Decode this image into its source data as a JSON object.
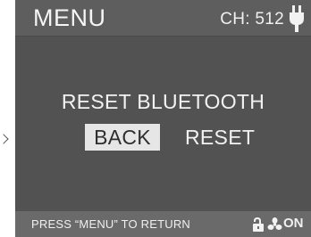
{
  "header": {
    "title": "MENU",
    "channel": "CH: 512",
    "power_icon": "plug-icon"
  },
  "dialog": {
    "headline": "RESET BLUETOOTH",
    "options": [
      {
        "label": "BACK",
        "selected": true
      },
      {
        "label": "RESET",
        "selected": false
      }
    ]
  },
  "footer": {
    "hint": "PRESS “MENU” TO RETURN",
    "lock_icon": "unlocked-padlock-icon",
    "fan_icon": "fan-icon",
    "fan_state": "ON"
  },
  "colors": {
    "screen_bg": "#585858",
    "content_bg": "#525252",
    "footer_bg": "#6a6a6a",
    "text": "#f2f2f2",
    "selected_bg": "#e6e6e6",
    "selected_text": "#2e2e2e"
  }
}
